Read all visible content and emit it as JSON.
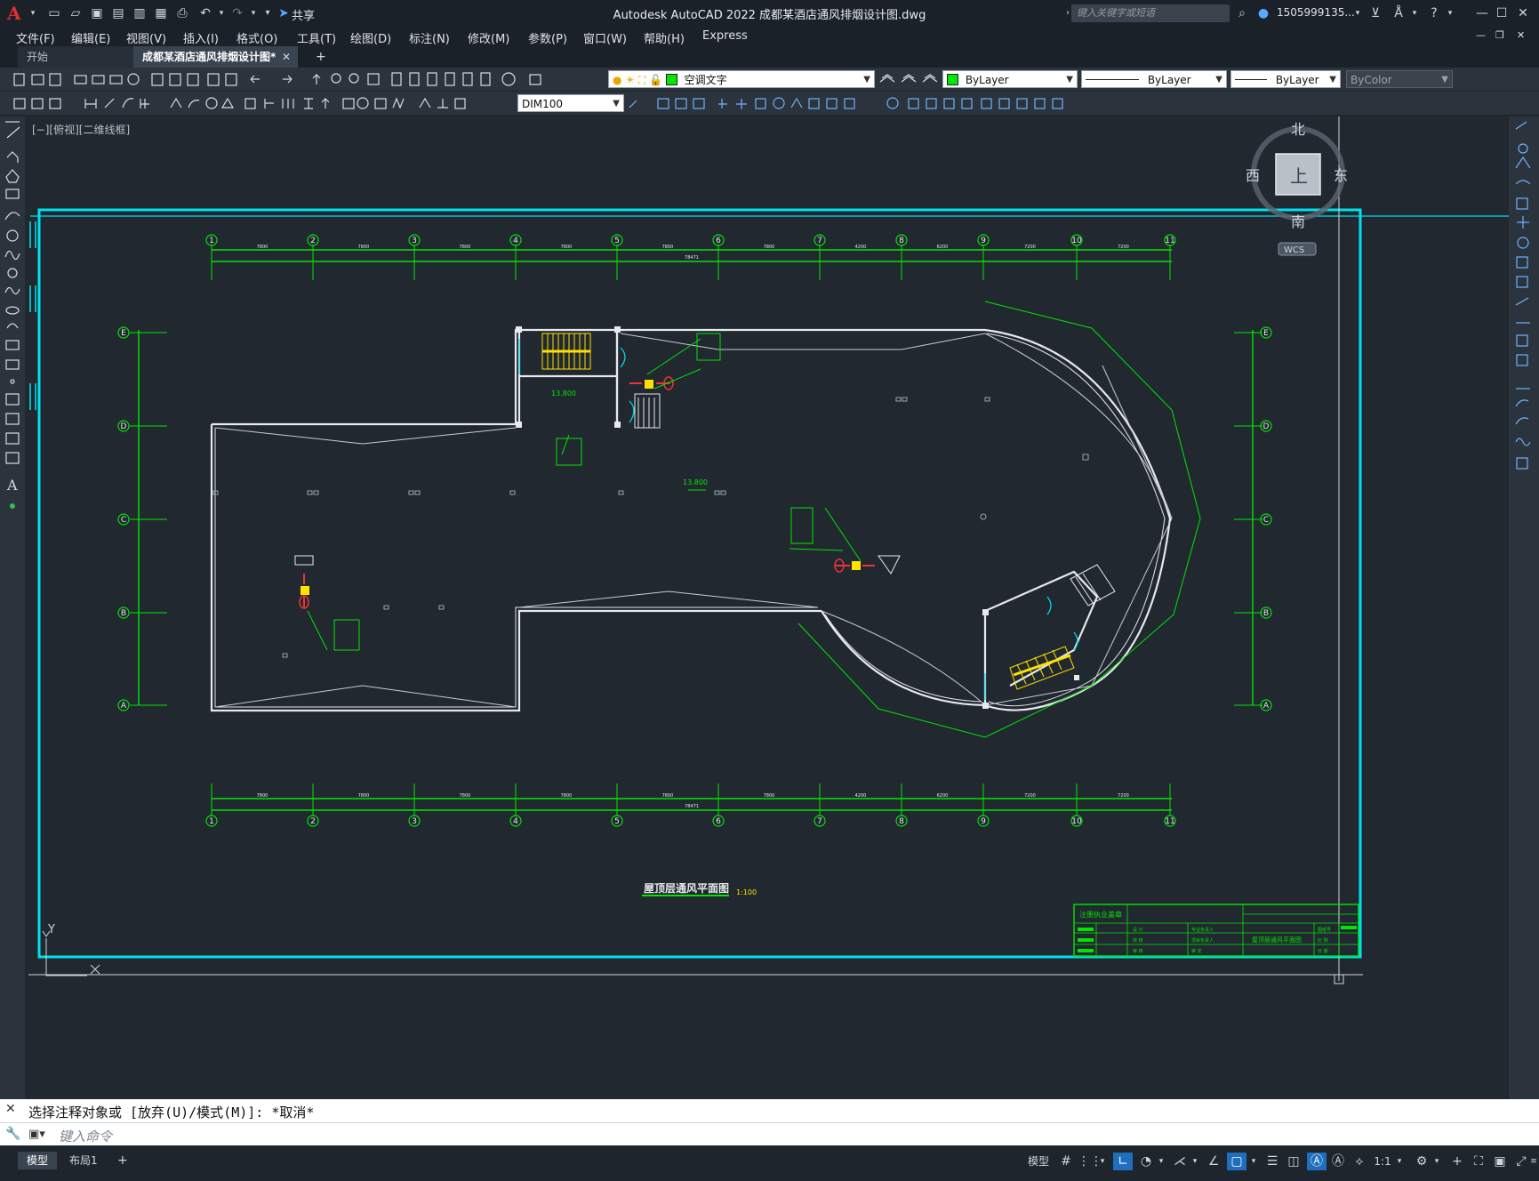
{
  "app": {
    "title": "Autodesk AutoCAD 2022    成都某酒店通风排烟设计图.dwg",
    "share_label": "共享",
    "search_placeholder": "键入关键字或短语",
    "user_name": "1505999135..."
  },
  "menu": [
    "文件(F)",
    "编辑(E)",
    "视图(V)",
    "插入(I)",
    "格式(O)",
    "工具(T)",
    "绘图(D)",
    "标注(N)",
    "修改(M)",
    "参数(P)",
    "窗口(W)",
    "帮助(H)",
    "Express"
  ],
  "tabs": {
    "start": "开始",
    "drawing": "成都某酒店通风排烟设计图*",
    "close": "✕",
    "add": "+"
  },
  "toolbar": {
    "layer_name": "空调文字",
    "color": "ByLayer",
    "linetype": "ByLayer",
    "lineweight": "ByLayer",
    "plotstyle": "ByColor",
    "dimstyle": "DIM100"
  },
  "viewport": {
    "label": "[−][俯视][二维线框]",
    "compass": {
      "north": "北",
      "south": "南",
      "east": "东",
      "west": "西",
      "top": "上"
    },
    "wcs": "WCS",
    "ucs_y": "Y",
    "ucs_x": "X"
  },
  "drawing": {
    "title": "屋顶层通风平面图",
    "scale": "1:100",
    "grid_cols": [
      "1",
      "2",
      "3",
      "4",
      "5",
      "6",
      "7",
      "8",
      "9",
      "10",
      "11"
    ],
    "grid_rows": [
      "E",
      "D",
      "C",
      "B",
      "A"
    ],
    "dim_spans": [
      "7800",
      "7800",
      "7800",
      "7800",
      "7800",
      "7800",
      "4200",
      "6200",
      "7200",
      "7200"
    ],
    "dim_total": "78471",
    "elev_1": "13.800",
    "elev_2": "13.800",
    "title_block": {
      "stamp": "注册执业盖章",
      "drawing_name": "屋顶层通风平面图",
      "rows": [
        "设  计",
        "校  核",
        "审  核"
      ],
      "roles": [
        "专业负责人",
        "项目负责人",
        "审  定"
      ],
      "meta": [
        "图纸号",
        "比 例",
        "日 期"
      ]
    }
  },
  "command": {
    "history": "选择注释对象或 [放弃(U)/模式(M)]: *取消*",
    "placeholder": "键入命令"
  },
  "status": {
    "model_tab": "模型",
    "layout_tab": "布局1",
    "add": "+",
    "model_button": "模型",
    "scale": "1:1"
  }
}
